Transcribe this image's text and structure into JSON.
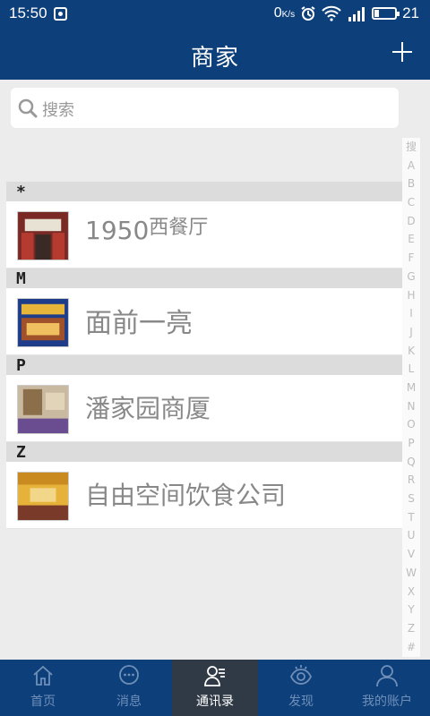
{
  "status_bar": {
    "time": "15:50",
    "speed": "0",
    "speed_unit": "K/s",
    "battery": "21"
  },
  "header": {
    "title": "商家"
  },
  "search": {
    "placeholder": "搜索"
  },
  "sections": [
    {
      "letter": "*",
      "items": [
        {
          "name": "1950",
          "name_suffix": "西餐厅"
        }
      ]
    },
    {
      "letter": "M",
      "items": [
        {
          "name": "面前一亮"
        }
      ]
    },
    {
      "letter": "P",
      "items": [
        {
          "name": "潘家园商厦"
        }
      ]
    },
    {
      "letter": "Z",
      "items": [
        {
          "name": "自由空间饮食公司"
        }
      ]
    }
  ],
  "index_letters": [
    "搜",
    "A",
    "B",
    "C",
    "D",
    "E",
    "F",
    "G",
    "H",
    "I",
    "J",
    "K",
    "L",
    "M",
    "N",
    "O",
    "P",
    "Q",
    "R",
    "S",
    "T",
    "U",
    "V",
    "W",
    "X",
    "Y",
    "Z",
    "#"
  ],
  "tabs": [
    {
      "label": "首页",
      "icon": "home-icon"
    },
    {
      "label": "消息",
      "icon": "message-icon"
    },
    {
      "label": "通讯录",
      "icon": "contacts-icon",
      "active": true
    },
    {
      "label": "发现",
      "icon": "eye-icon"
    },
    {
      "label": "我的账户",
      "icon": "user-icon"
    }
  ],
  "colors": {
    "bar": "#0d3f7a",
    "active_tab": "#303a47",
    "background": "#ececec"
  }
}
